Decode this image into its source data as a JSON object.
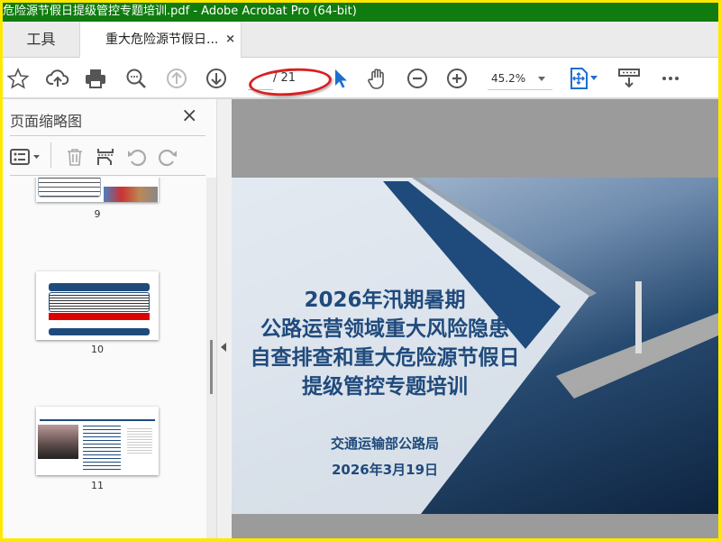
{
  "window": {
    "title": "危险源节假日提级管控专题培训.pdf - Adobe Acrobat Pro (64-bit)"
  },
  "tabs": {
    "tools": "工具",
    "document": "重大危险源节假日...",
    "close": "×"
  },
  "toolbar": {
    "page_current": "",
    "page_total": "/ 21",
    "zoom": "45.2%"
  },
  "panel": {
    "title": "页面缩略图",
    "close": "×",
    "thumbnails": [
      {
        "page": "9"
      },
      {
        "page": "10"
      },
      {
        "page": "11"
      }
    ]
  },
  "slide": {
    "title_lines": [
      "2026年汛期暑期",
      "公路运营领域重大风险隐患",
      "自查排查和重大危险源节假日",
      "提级管控专题培训"
    ],
    "org": "交通运输部公路局",
    "date": "2026年3月19日"
  },
  "colors": {
    "titlebar": "#107c10",
    "accent": "#1f4a7c",
    "annotation": "#d82020",
    "select_tool": "#1e6fcf"
  }
}
